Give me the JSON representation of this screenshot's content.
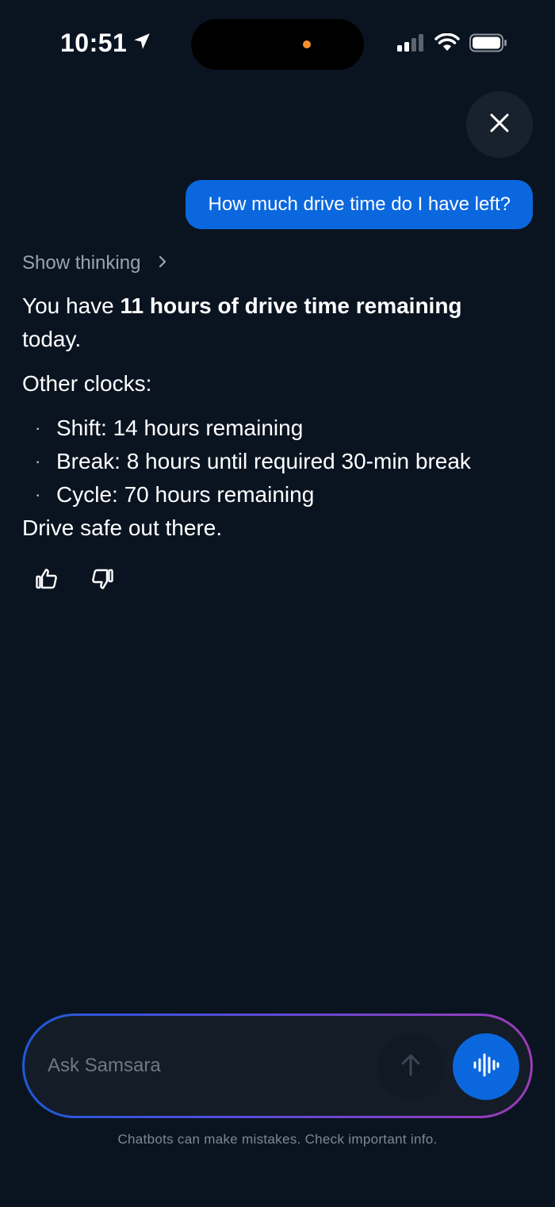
{
  "status_bar": {
    "time": "10:51",
    "icons": [
      "location-arrow-icon",
      "cellular-signal-icon",
      "wifi-icon",
      "battery-icon"
    ],
    "recording_dot_color": "#f7902b"
  },
  "header": {
    "close_icon": "close-icon"
  },
  "conversation": {
    "user_message": "How much drive time do I have left?",
    "show_thinking_label": "Show thinking",
    "response": {
      "intro_prefix": "You have ",
      "intro_bold": "11 hours of drive time remaining",
      "intro_suffix": " today.",
      "other_clocks_label": "Other clocks:",
      "bullet_char": "·",
      "clocks": [
        "Shift: 14 hours remaining",
        "Break: 8 hours until required 30-min break",
        "Cycle: 70 hours remaining"
      ],
      "closing": "Drive safe out there."
    },
    "feedback_icons": [
      "thumbs-up-icon",
      "thumbs-down-icon"
    ]
  },
  "composer": {
    "placeholder": "Ask Samsara",
    "send_icon": "arrow-up-icon",
    "voice_icon": "voice-waveform-icon"
  },
  "disclaimer": "Chatbots can make mistakes. Check important info.",
  "colors": {
    "background": "#0a1421",
    "accent": "#0b67de",
    "muted_text": "#9aa4b1"
  }
}
